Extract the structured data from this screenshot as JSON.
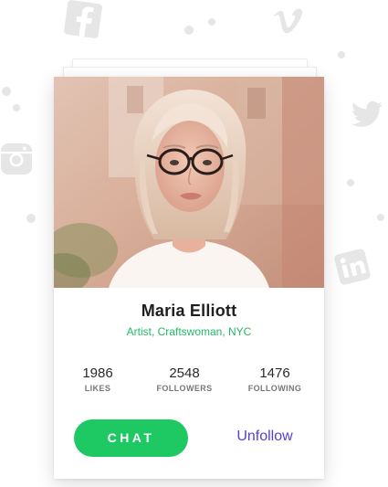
{
  "profile": {
    "name": "Maria Elliott",
    "subtitle": "Artist, Craftswoman, NYC"
  },
  "stats": [
    {
      "value": "1986",
      "label": "LIKES"
    },
    {
      "value": "2548",
      "label": "FOLLOWERS"
    },
    {
      "value": "1476",
      "label": "FOLLOWING"
    }
  ],
  "actions": {
    "chat_label": "CHAT",
    "unfollow_label": "Unfollow"
  },
  "background_icons": [
    "facebook-icon",
    "vimeo-icon",
    "twitter-icon",
    "instagram-icon",
    "linkedin-icon"
  ],
  "colors": {
    "accent_green": "#1ec964",
    "subtitle_green": "#1fbb63",
    "link_purple": "#5a3fd1",
    "decor_gray": "#e6e6e6"
  }
}
